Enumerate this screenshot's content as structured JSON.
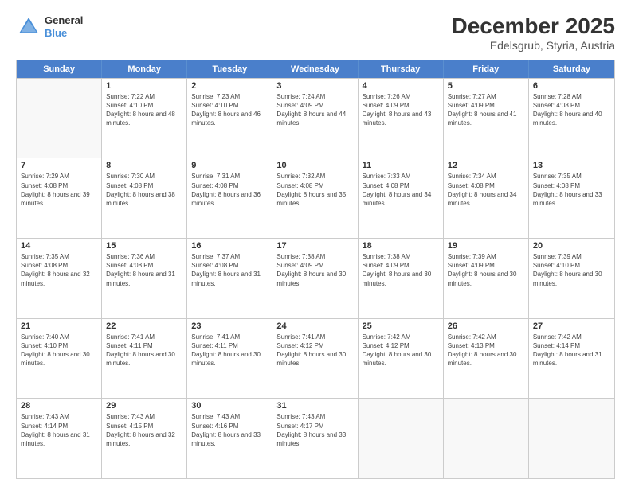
{
  "header": {
    "logo_general": "General",
    "logo_blue": "Blue",
    "title": "December 2025",
    "subtitle": "Edelsgrub, Styria, Austria"
  },
  "calendar": {
    "days": [
      "Sunday",
      "Monday",
      "Tuesday",
      "Wednesday",
      "Thursday",
      "Friday",
      "Saturday"
    ],
    "rows": [
      [
        {
          "day": "",
          "empty": true
        },
        {
          "day": "1",
          "rise": "7:22 AM",
          "set": "4:10 PM",
          "daylight": "8 hours and 48 minutes."
        },
        {
          "day": "2",
          "rise": "7:23 AM",
          "set": "4:10 PM",
          "daylight": "8 hours and 46 minutes."
        },
        {
          "day": "3",
          "rise": "7:24 AM",
          "set": "4:09 PM",
          "daylight": "8 hours and 44 minutes."
        },
        {
          "day": "4",
          "rise": "7:26 AM",
          "set": "4:09 PM",
          "daylight": "8 hours and 43 minutes."
        },
        {
          "day": "5",
          "rise": "7:27 AM",
          "set": "4:09 PM",
          "daylight": "8 hours and 41 minutes."
        },
        {
          "day": "6",
          "rise": "7:28 AM",
          "set": "4:08 PM",
          "daylight": "8 hours and 40 minutes."
        }
      ],
      [
        {
          "day": "7",
          "rise": "7:29 AM",
          "set": "4:08 PM",
          "daylight": "8 hours and 39 minutes."
        },
        {
          "day": "8",
          "rise": "7:30 AM",
          "set": "4:08 PM",
          "daylight": "8 hours and 38 minutes."
        },
        {
          "day": "9",
          "rise": "7:31 AM",
          "set": "4:08 PM",
          "daylight": "8 hours and 36 minutes."
        },
        {
          "day": "10",
          "rise": "7:32 AM",
          "set": "4:08 PM",
          "daylight": "8 hours and 35 minutes."
        },
        {
          "day": "11",
          "rise": "7:33 AM",
          "set": "4:08 PM",
          "daylight": "8 hours and 34 minutes."
        },
        {
          "day": "12",
          "rise": "7:34 AM",
          "set": "4:08 PM",
          "daylight": "8 hours and 34 minutes."
        },
        {
          "day": "13",
          "rise": "7:35 AM",
          "set": "4:08 PM",
          "daylight": "8 hours and 33 minutes."
        }
      ],
      [
        {
          "day": "14",
          "rise": "7:35 AM",
          "set": "4:08 PM",
          "daylight": "8 hours and 32 minutes."
        },
        {
          "day": "15",
          "rise": "7:36 AM",
          "set": "4:08 PM",
          "daylight": "8 hours and 31 minutes."
        },
        {
          "day": "16",
          "rise": "7:37 AM",
          "set": "4:08 PM",
          "daylight": "8 hours and 31 minutes."
        },
        {
          "day": "17",
          "rise": "7:38 AM",
          "set": "4:09 PM",
          "daylight": "8 hours and 30 minutes."
        },
        {
          "day": "18",
          "rise": "7:38 AM",
          "set": "4:09 PM",
          "daylight": "8 hours and 30 minutes."
        },
        {
          "day": "19",
          "rise": "7:39 AM",
          "set": "4:09 PM",
          "daylight": "8 hours and 30 minutes."
        },
        {
          "day": "20",
          "rise": "7:39 AM",
          "set": "4:10 PM",
          "daylight": "8 hours and 30 minutes."
        }
      ],
      [
        {
          "day": "21",
          "rise": "7:40 AM",
          "set": "4:10 PM",
          "daylight": "8 hours and 30 minutes."
        },
        {
          "day": "22",
          "rise": "7:41 AM",
          "set": "4:11 PM",
          "daylight": "8 hours and 30 minutes."
        },
        {
          "day": "23",
          "rise": "7:41 AM",
          "set": "4:11 PM",
          "daylight": "8 hours and 30 minutes."
        },
        {
          "day": "24",
          "rise": "7:41 AM",
          "set": "4:12 PM",
          "daylight": "8 hours and 30 minutes."
        },
        {
          "day": "25",
          "rise": "7:42 AM",
          "set": "4:12 PM",
          "daylight": "8 hours and 30 minutes."
        },
        {
          "day": "26",
          "rise": "7:42 AM",
          "set": "4:13 PM",
          "daylight": "8 hours and 30 minutes."
        },
        {
          "day": "27",
          "rise": "7:42 AM",
          "set": "4:14 PM",
          "daylight": "8 hours and 31 minutes."
        }
      ],
      [
        {
          "day": "28",
          "rise": "7:43 AM",
          "set": "4:14 PM",
          "daylight": "8 hours and 31 minutes."
        },
        {
          "day": "29",
          "rise": "7:43 AM",
          "set": "4:15 PM",
          "daylight": "8 hours and 32 minutes."
        },
        {
          "day": "30",
          "rise": "7:43 AM",
          "set": "4:16 PM",
          "daylight": "8 hours and 33 minutes."
        },
        {
          "day": "31",
          "rise": "7:43 AM",
          "set": "4:17 PM",
          "daylight": "8 hours and 33 minutes."
        },
        {
          "day": "",
          "empty": true
        },
        {
          "day": "",
          "empty": true
        },
        {
          "day": "",
          "empty": true
        }
      ]
    ]
  }
}
